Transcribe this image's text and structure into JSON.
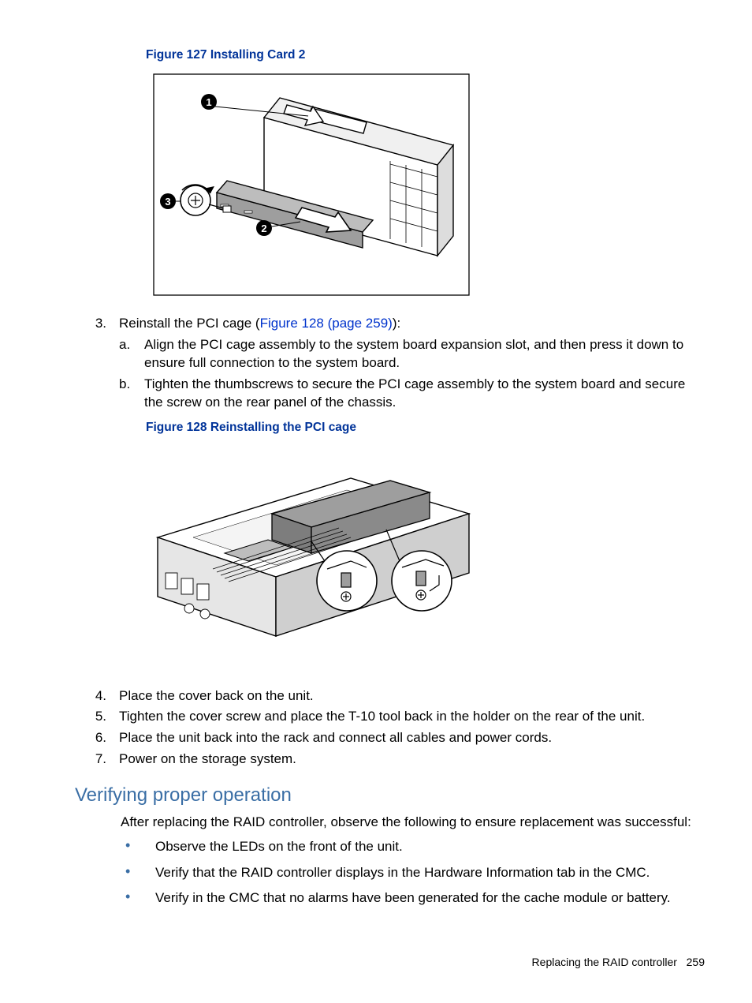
{
  "figure127": {
    "caption": "Figure 127 Installing Card 2",
    "callouts": [
      "1",
      "2",
      "3"
    ]
  },
  "step3": {
    "num": "3.",
    "lead": "Reinstall the PCI cage (",
    "link": "Figure 128 (page 259)",
    "tail": "):",
    "a": {
      "letter": "a.",
      "text": "Align the PCI cage assembly to the system board expansion slot, and then press it down to ensure full connection to the system board."
    },
    "b": {
      "letter": "b.",
      "text": "Tighten the thumbscrews to secure the PCI cage assembly to the system board and secure the screw on the rear panel of the chassis."
    }
  },
  "figure128": {
    "caption": "Figure 128 Reinstalling the PCI cage"
  },
  "step4": {
    "num": "4.",
    "text": "Place the cover back on the unit."
  },
  "step5": {
    "num": "5.",
    "text": "Tighten the cover screw and place the T-10 tool back in the holder on the rear of the unit."
  },
  "step6": {
    "num": "6.",
    "text": "Place the unit back into the rack and connect all cables and power cords."
  },
  "step7": {
    "num": "7.",
    "text": "Power on the storage system."
  },
  "section": {
    "heading": "Verifying proper operation",
    "intro": "After replacing the RAID controller, observe the following to ensure replacement was successful:",
    "bullets": [
      "Observe the LEDs on the front of the unit.",
      "Verify that the RAID controller displays in the Hardware Information tab in the CMC.",
      "Verify in the CMC that no alarms have been generated for the cache module or battery."
    ]
  },
  "footer": {
    "title": "Replacing the RAID controller",
    "page": "259"
  }
}
